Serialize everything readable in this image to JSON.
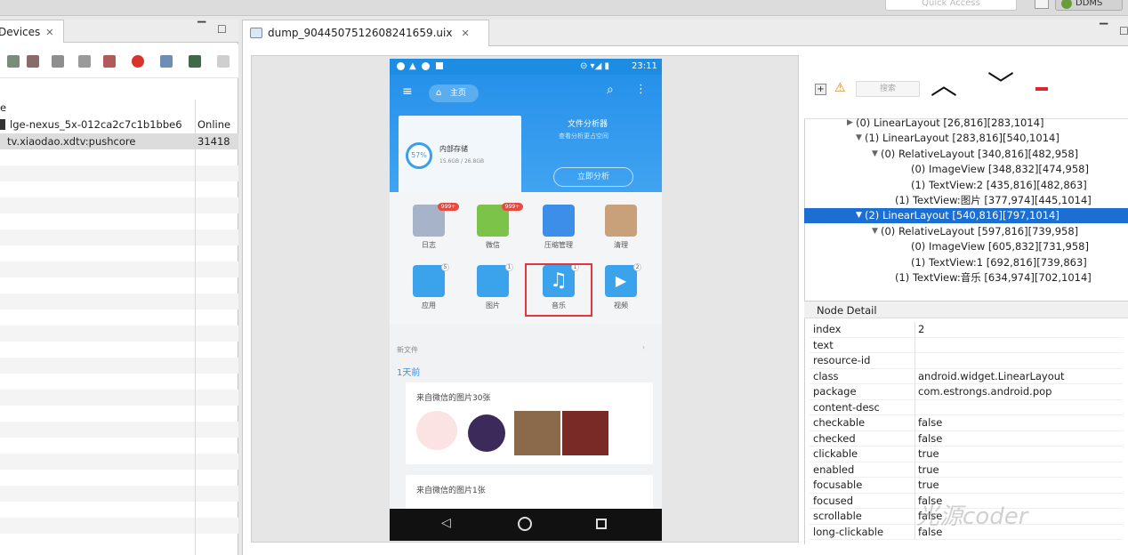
{
  "toolbar": {
    "quick_access": "Quick Access",
    "perspective_label": "DDMS"
  },
  "devices": {
    "tab_label": "Devices",
    "column_header": "e",
    "rows": [
      {
        "name": "lge-nexus_5x-012ca2c7c1b1bbe6",
        "status": "Online"
      },
      {
        "name": "tv.xiaodao.xdtv:pushcore",
        "status": "31418"
      }
    ]
  },
  "editor": {
    "tab_label": "dump_9044507512608241659.uix"
  },
  "phone": {
    "time": "23:11",
    "home_label": "主页",
    "storage_title": "内部存储",
    "storage_detail": "15.6GB / 26.8GB",
    "storage_percent": "57%",
    "analysis_title": "文件分析器",
    "analysis_sub": "查看分析更占空间",
    "analyze_button": "立即分析",
    "grid": [
      {
        "label": "日志",
        "color": "#a6b3c8",
        "badge": "999+"
      },
      {
        "label": "微信",
        "color": "#7cc34a",
        "badge": "999+"
      },
      {
        "label": "压缩管理",
        "color": "#3d8ee8",
        "badge": ""
      },
      {
        "label": "清理",
        "color": "#c8a17a",
        "badge": ""
      },
      {
        "label": "应用",
        "color": "#3aa3ec",
        "badge": "5"
      },
      {
        "label": "图片",
        "color": "#3aa3ec",
        "badge": "1"
      },
      {
        "label": "音乐",
        "color": "#3aa3ec",
        "badge": "1"
      },
      {
        "label": "视频",
        "color": "#3aa3ec",
        "badge": "2"
      }
    ],
    "section_label": "新文件",
    "day_label": "1天前",
    "card1_title": "来自微信的图片30张",
    "card2_title": "来自微信的图片1张"
  },
  "tree": {
    "search_placeholder": "搜索",
    "nodes": [
      {
        "indent": 48,
        "arrow": "▶",
        "text": "(0) LinearLayout [26,816][283,1014]",
        "selected": false
      },
      {
        "indent": 58,
        "arrow": "▼",
        "text": "(1) LinearLayout [283,816][540,1014]",
        "selected": false
      },
      {
        "indent": 76,
        "arrow": "▼",
        "text": "(0) RelativeLayout [340,816][482,958]",
        "selected": false
      },
      {
        "indent": 110,
        "arrow": "",
        "text": "(0) ImageView [348,832][474,958]",
        "selected": false
      },
      {
        "indent": 110,
        "arrow": "",
        "text": "(1) TextView:2 [435,816][482,863]",
        "selected": false
      },
      {
        "indent": 92,
        "arrow": "",
        "text": "(1) TextView:图片 [377,974][445,1014]",
        "selected": false
      },
      {
        "indent": 58,
        "arrow": "▼",
        "text": "(2) LinearLayout [540,816][797,1014]",
        "selected": true
      },
      {
        "indent": 76,
        "arrow": "▼",
        "text": "(0) RelativeLayout [597,816][739,958]",
        "selected": false
      },
      {
        "indent": 110,
        "arrow": "",
        "text": "(0) ImageView [605,832][731,958]",
        "selected": false
      },
      {
        "indent": 110,
        "arrow": "",
        "text": "(1) TextView:1 [692,816][739,863]",
        "selected": false
      },
      {
        "indent": 92,
        "arrow": "",
        "text": "(1) TextView:音乐 [634,974][702,1014]",
        "selected": false
      }
    ]
  },
  "node_detail": {
    "title": "Node Detail",
    "rows": [
      {
        "k": "index",
        "v": "2"
      },
      {
        "k": "text",
        "v": ""
      },
      {
        "k": "resource-id",
        "v": ""
      },
      {
        "k": "class",
        "v": "android.widget.LinearLayout"
      },
      {
        "k": "package",
        "v": "com.estrongs.android.pop"
      },
      {
        "k": "content-desc",
        "v": ""
      },
      {
        "k": "checkable",
        "v": "false"
      },
      {
        "k": "checked",
        "v": "false"
      },
      {
        "k": "clickable",
        "v": "true"
      },
      {
        "k": "enabled",
        "v": "true"
      },
      {
        "k": "focusable",
        "v": "true"
      },
      {
        "k": "focused",
        "v": "false"
      },
      {
        "k": "scrollable",
        "v": "false"
      },
      {
        "k": "long-clickable",
        "v": "false"
      }
    ]
  },
  "watermark": "光源coder"
}
